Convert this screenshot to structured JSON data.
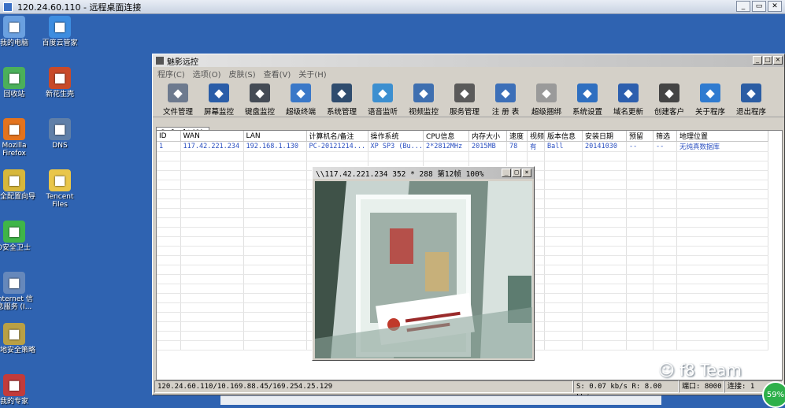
{
  "rdp": {
    "title": "120.24.60.110 - 远程桌面连接"
  },
  "desktop_icons": [
    {
      "label": "我的电脑",
      "icon": "computer-icon",
      "color": "#6aa0e0"
    },
    {
      "label": "百度云管家",
      "icon": "cloud-icon",
      "color": "#3d8de0"
    },
    {
      "label": "回收站",
      "icon": "recycle-bin-icon",
      "color": "#4bb05a"
    },
    {
      "label": "新花生壳",
      "icon": "peanut-shell-icon",
      "color": "#c84a2a"
    },
    {
      "label": "Mozilla Firefox",
      "icon": "firefox-icon",
      "color": "#e3731e"
    },
    {
      "label": "DNS",
      "icon": "network-icon",
      "color": "#5f7fa8"
    },
    {
      "label": "安全配置向导",
      "icon": "security-wizard-icon",
      "color": "#d7b73b"
    },
    {
      "label": "Tencent Files",
      "icon": "folder-icon",
      "color": "#e9c64a"
    },
    {
      "label": "0安全卫士",
      "icon": "security-guard-icon",
      "color": "#3fb548"
    },
    {
      "label": "Internet 信息服务 (I...",
      "icon": "iis-icon",
      "color": "#6688bb"
    },
    {
      "label": "本地安全策略",
      "icon": "local-policy-icon",
      "color": "#b9a045"
    },
    {
      "label": "我的专家",
      "icon": "expert-icon",
      "color": "#c23b3b"
    }
  ],
  "app": {
    "title": "魅影远控",
    "menu": [
      "程序(C)",
      "选项(O)",
      "皮肤(S)",
      "查看(V)",
      "关于(H)"
    ],
    "toolbar": [
      {
        "label": "文件管理",
        "icon": "file-manager-icon",
        "color": "#6d7a8e"
      },
      {
        "label": "屏幕监控",
        "icon": "monitor-icon",
        "color": "#2a5da8"
      },
      {
        "label": "键盘监控",
        "icon": "keyboard-icon",
        "color": "#444b55"
      },
      {
        "label": "超级终端",
        "icon": "terminal-icon",
        "color": "#3a78c8"
      },
      {
        "label": "系统管理",
        "icon": "system-icon",
        "color": "#2f4c6e"
      },
      {
        "label": "语音监听",
        "icon": "audio-icon",
        "color": "#3c8fd0"
      },
      {
        "label": "视频监控",
        "icon": "video-icon",
        "color": "#3e6fb0"
      },
      {
        "label": "服务管理",
        "icon": "service-icon",
        "color": "#5a5a5a"
      },
      {
        "label": "注 册 表",
        "icon": "registry-icon",
        "color": "#3c6fb8"
      },
      {
        "label": "超级捆绑",
        "icon": "bundle-icon",
        "color": "#9a9a9a"
      },
      {
        "label": "系统设置",
        "icon": "settings-icon",
        "color": "#2f6fc0"
      },
      {
        "label": "域名更新",
        "icon": "domain-icon",
        "color": "#2d5fae"
      },
      {
        "label": "创建客户",
        "icon": "create-client-icon",
        "color": "#444"
      },
      {
        "label": "关于程序",
        "icon": "about-icon",
        "color": "#2f7bd0"
      },
      {
        "label": "退出程序",
        "icon": "exit-icon",
        "color": "#2b5da4"
      }
    ],
    "tab": "Default(1)",
    "columns": [
      "ID",
      "WAN",
      "LAN",
      "计算机名/备注",
      "操作系统",
      "CPU信息",
      "内存大小",
      "速度",
      "视频",
      "版本信息",
      "安装日期",
      "预留",
      "筛选",
      "地理位置"
    ],
    "rows": [
      [
        "1",
        "117.42.221.234",
        "192.168.1.130",
        "PC-20121214...",
        "XP SP3 (Bu...",
        "2*2812MHz",
        "2015MB",
        "78",
        "有",
        "Ball",
        "20141030",
        "--",
        "--",
        "无纯真数据库"
      ]
    ],
    "status": {
      "address": "120.24.60.110/10.169.88.45/169.254.25.129",
      "speed": "S: 0.07 kb/s R: 8.00 kb/s",
      "port": "端口: 8000",
      "connections": "连接: 1"
    }
  },
  "cam": {
    "title": "\\\\117.42.221.234 352 * 288 第12帧 100%"
  },
  "watermark": "f8 Team",
  "badge": "59%"
}
